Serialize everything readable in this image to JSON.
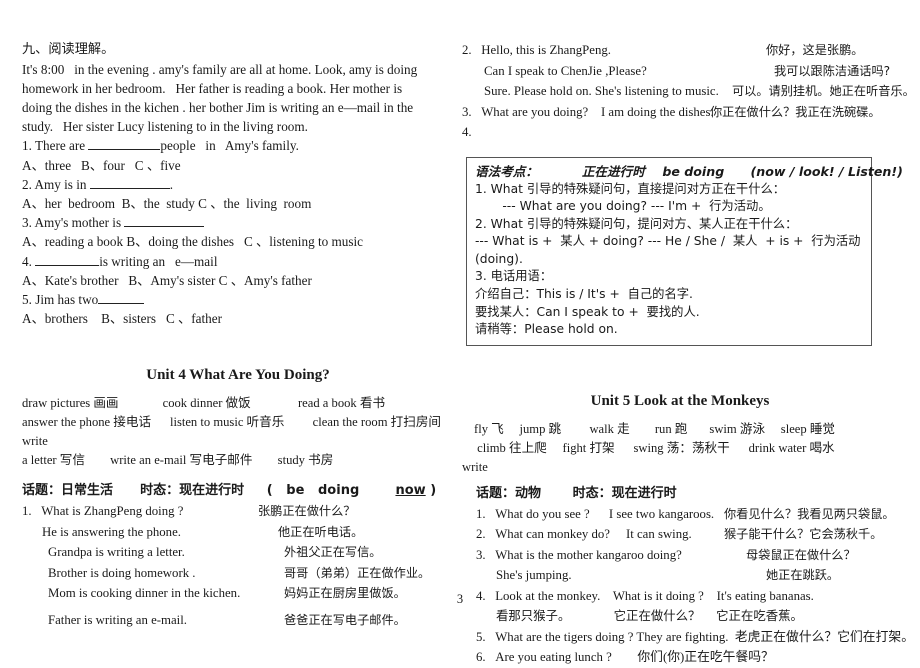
{
  "page_number": "3",
  "left_column": {
    "reading": {
      "heading": "九、阅读理解。",
      "passage": [
        "It's 8:00   in the evening . amy's family are all at home. Look, amy is doing",
        "homework in her bedroom.   Her father is reading a book. Her mother is",
        "doing the dishes in the kichen . her bother Jim is writing an e—mail in the",
        "study.   Her sister Lucy listening to in the living room."
      ],
      "questions": [
        {
          "q_prefix": "1. There are ",
          "q_suffix": "people   in   Amy's family.",
          "options": "A、three   B、four   C 、five"
        },
        {
          "q_prefix": "2. Amy is in ",
          "q_suffix": ".",
          "options": "A、her  bedroom  B、the  study C 、the  living  room"
        },
        {
          "q_prefix": "3. Amy's mother is ",
          "q_suffix": "",
          "options": "A、reading a book B、doing the dishes   C 、listening to music"
        },
        {
          "q_prefix": "4. ",
          "q_suffix": "is writing an   e—mail",
          "options": "A、Kate's brother   B、Amy's sister C 、Amy's father"
        },
        {
          "q_prefix": "5. Jim has two",
          "q_suffix": "",
          "options": "A、brothers    B、sisters   C 、father"
        }
      ]
    },
    "unit4": {
      "title": "Unit 4 What Are You Doing?",
      "vocab_lines": [
        "draw pictures 画画              cook dinner 做饭               read a book 看书",
        "answer the phone 接电话      listen to music 听音乐         clean the room 打扫房间        write",
        "a letter 写信        write an e-mail 写电子邮件        study 书房"
      ],
      "topic_prefix": "话题：日常生活      时态：现在进行时     (   be   doing        ",
      "topic_underlined": "now",
      "topic_suffix": " )",
      "dialogue": [
        {
          "num": "1.",
          "en": "What is ZhangPeng doing ?",
          "cn": "张鹏正在做什么？"
        },
        {
          "num": "",
          "en": "He is answering the phone.",
          "cn": "他正在听电话。"
        },
        {
          "num": "",
          "en": "Grandpa is writing a letter.",
          "cn": "外祖父正在写信。"
        },
        {
          "num": "",
          "en": "Brother is doing homework .",
          "cn": "哥哥（弟弟）正在做作业。"
        },
        {
          "num": "",
          "en": "Mom is cooking dinner in the kichen.",
          "cn": "妈妈正在厨房里做饭。"
        },
        {
          "num": "",
          "en": "Father is writing an e-mail.",
          "cn": "爸爸正在写电子邮件。"
        }
      ]
    }
  },
  "right_column": {
    "dialogue_top": [
      {
        "num": "2.",
        "en": "Hello, this is ZhangPeng.",
        "cn": "你好，这是张鹏。",
        "cn_indent": 172
      },
      {
        "num": "",
        "en": "Can I speak to ChenJie ,Please?",
        "cn": "我可以跟陈洁通话吗?",
        "cn_indent": 160
      },
      {
        "num": "",
        "en": "Sure. Please hold on. She's listening to music.",
        "cn": "可以。请别挂机。她正在听音乐。",
        "cn_indent": 0
      },
      {
        "num": "3.",
        "en": "What are you doing?    I am doing the dishes.",
        "cn": "你正在做什么？我正在洗碗碟。",
        "cn_indent": 0
      },
      {
        "num": "4.",
        "en": "",
        "cn": "",
        "cn_indent": 0
      }
    ],
    "grammar_box": {
      "header": "语法考点：          正在进行时    be doing      (now / look! / Listen!)",
      "lines": [
        "1. What 引导的特殊疑问句，直接提问对方正在干什么：",
        "       --- What are you doing? --- I'm +  行为活动。",
        "2. What 引导的特殊疑问句，提问对方、某人正在干什么：",
        "--- What is +  某人 + doing? --- He / She /  某人  + is +  行为活动 (doing).",
        "3. 电话用语：",
        "介绍自己：This is / It's +  自己的名字.",
        "要找某人：Can I speak to +  要找的人.",
        "请稍等：Please hold on."
      ]
    },
    "unit5": {
      "title": "Unit 5 Look at the Monkeys",
      "vocab_lines": [
        "fly 飞     jump 跳         walk 走        run 跑       swim 游泳     sleep 睡觉",
        " climb 往上爬     fight 打架      swing 荡：荡秋干      drink water 喝水",
        "write"
      ],
      "topic": "话题：动物       时态：现在进行时",
      "dialogue": [
        {
          "num": "1.",
          "en": "What do you see ?      I see two kangaroos.",
          "cn": "你看见什么？我看见两只袋鼠。"
        },
        {
          "num": "2.",
          "en": "What can monkey do?     It can swing.",
          "cn": "猴子能干什么？它会荡秋千。"
        },
        {
          "num": "3.",
          "en": "What is the mother kangaroo doing?",
          "cn": "母袋鼠正在做什么？"
        },
        {
          "num": "",
          "en": "She's jumping.",
          "cn": "她正在跳跃。"
        },
        {
          "num": "4.",
          "en": "Look at the monkey.    What is it doing ?    It's eating bananas.",
          "cn": ""
        },
        {
          "num": "",
          "en": "看那只猴子。           它正在做什么？    它正在吃香蕉。",
          "cn": ""
        },
        {
          "num": "5.",
          "en": "What are the tigers doing ? They are fighting.  老虎正在做什么？它们在打架。",
          "cn": ""
        },
        {
          "num": "6.",
          "en": "Are you eating lunch ?        你们(你)正在吃午餐吗？",
          "cn": ""
        }
      ]
    }
  }
}
